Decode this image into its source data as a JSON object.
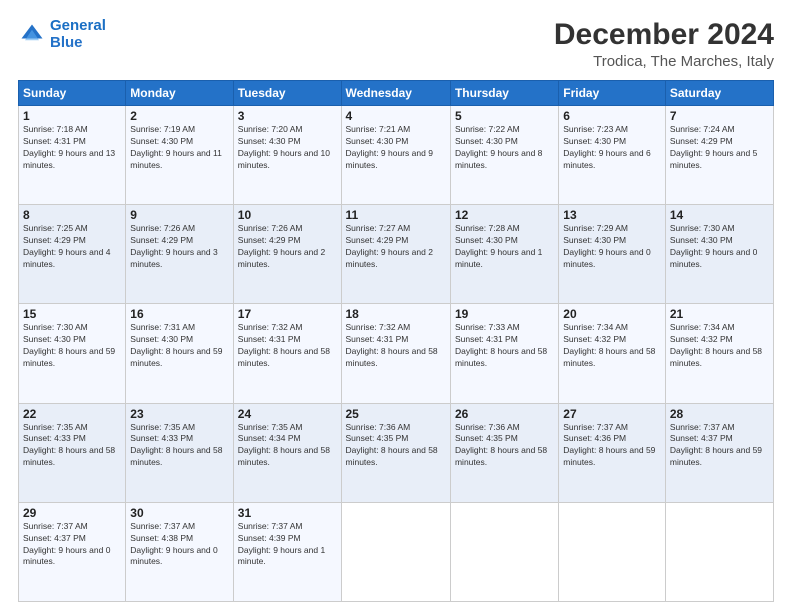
{
  "logo": {
    "line1": "General",
    "line2": "Blue"
  },
  "header": {
    "month": "December 2024",
    "location": "Trodica, The Marches, Italy"
  },
  "days_of_week": [
    "Sunday",
    "Monday",
    "Tuesday",
    "Wednesday",
    "Thursday",
    "Friday",
    "Saturday"
  ],
  "weeks": [
    [
      {
        "day": "1",
        "sunrise": "7:18 AM",
        "sunset": "4:31 PM",
        "daylight": "9 hours and 13 minutes."
      },
      {
        "day": "2",
        "sunrise": "7:19 AM",
        "sunset": "4:30 PM",
        "daylight": "9 hours and 11 minutes."
      },
      {
        "day": "3",
        "sunrise": "7:20 AM",
        "sunset": "4:30 PM",
        "daylight": "9 hours and 10 minutes."
      },
      {
        "day": "4",
        "sunrise": "7:21 AM",
        "sunset": "4:30 PM",
        "daylight": "9 hours and 9 minutes."
      },
      {
        "day": "5",
        "sunrise": "7:22 AM",
        "sunset": "4:30 PM",
        "daylight": "9 hours and 8 minutes."
      },
      {
        "day": "6",
        "sunrise": "7:23 AM",
        "sunset": "4:30 PM",
        "daylight": "9 hours and 6 minutes."
      },
      {
        "day": "7",
        "sunrise": "7:24 AM",
        "sunset": "4:29 PM",
        "daylight": "9 hours and 5 minutes."
      }
    ],
    [
      {
        "day": "8",
        "sunrise": "7:25 AM",
        "sunset": "4:29 PM",
        "daylight": "9 hours and 4 minutes."
      },
      {
        "day": "9",
        "sunrise": "7:26 AM",
        "sunset": "4:29 PM",
        "daylight": "9 hours and 3 minutes."
      },
      {
        "day": "10",
        "sunrise": "7:26 AM",
        "sunset": "4:29 PM",
        "daylight": "9 hours and 2 minutes."
      },
      {
        "day": "11",
        "sunrise": "7:27 AM",
        "sunset": "4:29 PM",
        "daylight": "9 hours and 2 minutes."
      },
      {
        "day": "12",
        "sunrise": "7:28 AM",
        "sunset": "4:30 PM",
        "daylight": "9 hours and 1 minute."
      },
      {
        "day": "13",
        "sunrise": "7:29 AM",
        "sunset": "4:30 PM",
        "daylight": "9 hours and 0 minutes."
      },
      {
        "day": "14",
        "sunrise": "7:30 AM",
        "sunset": "4:30 PM",
        "daylight": "9 hours and 0 minutes."
      }
    ],
    [
      {
        "day": "15",
        "sunrise": "7:30 AM",
        "sunset": "4:30 PM",
        "daylight": "8 hours and 59 minutes."
      },
      {
        "day": "16",
        "sunrise": "7:31 AM",
        "sunset": "4:30 PM",
        "daylight": "8 hours and 59 minutes."
      },
      {
        "day": "17",
        "sunrise": "7:32 AM",
        "sunset": "4:31 PM",
        "daylight": "8 hours and 58 minutes."
      },
      {
        "day": "18",
        "sunrise": "7:32 AM",
        "sunset": "4:31 PM",
        "daylight": "8 hours and 58 minutes."
      },
      {
        "day": "19",
        "sunrise": "7:33 AM",
        "sunset": "4:31 PM",
        "daylight": "8 hours and 58 minutes."
      },
      {
        "day": "20",
        "sunrise": "7:34 AM",
        "sunset": "4:32 PM",
        "daylight": "8 hours and 58 minutes."
      },
      {
        "day": "21",
        "sunrise": "7:34 AM",
        "sunset": "4:32 PM",
        "daylight": "8 hours and 58 minutes."
      }
    ],
    [
      {
        "day": "22",
        "sunrise": "7:35 AM",
        "sunset": "4:33 PM",
        "daylight": "8 hours and 58 minutes."
      },
      {
        "day": "23",
        "sunrise": "7:35 AM",
        "sunset": "4:33 PM",
        "daylight": "8 hours and 58 minutes."
      },
      {
        "day": "24",
        "sunrise": "7:35 AM",
        "sunset": "4:34 PM",
        "daylight": "8 hours and 58 minutes."
      },
      {
        "day": "25",
        "sunrise": "7:36 AM",
        "sunset": "4:35 PM",
        "daylight": "8 hours and 58 minutes."
      },
      {
        "day": "26",
        "sunrise": "7:36 AM",
        "sunset": "4:35 PM",
        "daylight": "8 hours and 58 minutes."
      },
      {
        "day": "27",
        "sunrise": "7:37 AM",
        "sunset": "4:36 PM",
        "daylight": "8 hours and 59 minutes."
      },
      {
        "day": "28",
        "sunrise": "7:37 AM",
        "sunset": "4:37 PM",
        "daylight": "8 hours and 59 minutes."
      }
    ],
    [
      {
        "day": "29",
        "sunrise": "7:37 AM",
        "sunset": "4:37 PM",
        "daylight": "9 hours and 0 minutes."
      },
      {
        "day": "30",
        "sunrise": "7:37 AM",
        "sunset": "4:38 PM",
        "daylight": "9 hours and 0 minutes."
      },
      {
        "day": "31",
        "sunrise": "7:37 AM",
        "sunset": "4:39 PM",
        "daylight": "9 hours and 1 minute."
      },
      null,
      null,
      null,
      null
    ]
  ]
}
